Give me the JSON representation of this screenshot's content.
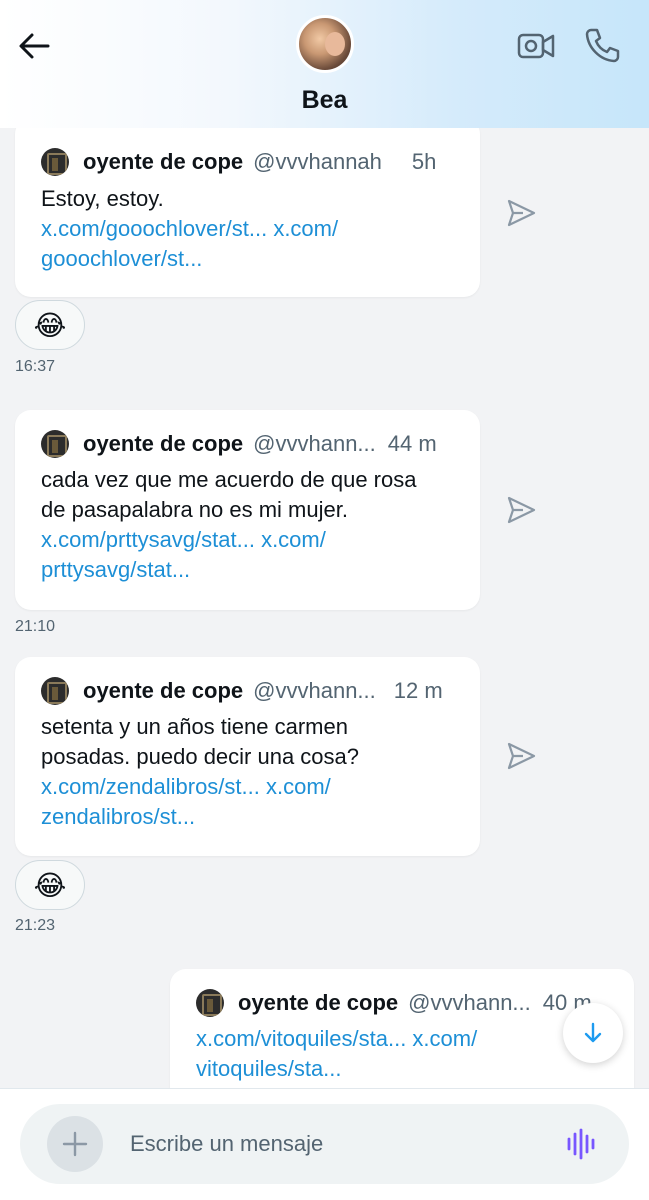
{
  "header": {
    "contact_name": "Bea"
  },
  "messages": [
    {
      "display_name": "oyente de cope",
      "handle": "@vvvhannah",
      "time": "5h",
      "text": "Estoy, estoy.",
      "link_line1": "x.com/gooochlover/st... x.com/",
      "link_line2": "gooochlover/st...",
      "reaction": "😂",
      "timestamp": "16:37"
    },
    {
      "display_name": "oyente de cope",
      "handle": "@vvvhann...",
      "time": "44 m",
      "text_line1": "cada vez que me acuerdo de que rosa",
      "text_line2": "de pasapalabra no es mi mujer.",
      "link_line1": "x.com/prttysavg/stat... x.com/",
      "link_line2": "prttysavg/stat...",
      "timestamp": "21:10"
    },
    {
      "display_name": "oyente de cope",
      "handle": "@vvvhann...",
      "time": "12 m",
      "text_line1": "setenta y un años tiene carmen",
      "text_line2": "posadas. puedo decir una cosa?",
      "link_line1": "x.com/zendalibros/st... x.com/",
      "link_line2": "zendalibros/st...",
      "reaction": "😂",
      "timestamp": "21:23"
    },
    {
      "display_name": "oyente de cope",
      "handle": "@vvvhann...",
      "time": "40 m",
      "link_line1": "x.com/vitoquiles/sta... x.com/",
      "link_line2": "vitoquiles/sta..."
    }
  ],
  "composer": {
    "placeholder": "Escribe un mensaje"
  },
  "colors": {
    "link": "#1d8fd6",
    "voice_icon": "#7856ff",
    "accent": "#1d9bf0"
  },
  "icons": [
    "back-arrow-icon",
    "video-camera-icon",
    "phone-icon",
    "share-icon",
    "plus-icon",
    "voice-waveform-icon",
    "arrow-down-icon"
  ]
}
